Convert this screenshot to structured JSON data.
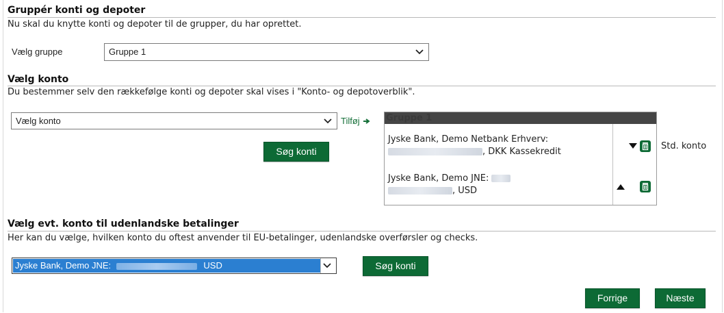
{
  "group_section": {
    "title": "Gruppér konti og depoter",
    "description": "Nu skal du knytte konti og depoter til de grupper, du har oprettet.",
    "select_label": "Vælg gruppe",
    "selected_group": "Gruppe 1"
  },
  "account_section": {
    "title": "Vælg konto",
    "description": "Du bestemmer selv den rækkefølge konti og depoter skal vises i \"Konto- og depotoverblik\".",
    "account_select_value": "Vælg konto",
    "add_link": "Tilføj",
    "search_button": "Søg konti",
    "group_box": {
      "header": "Gruppe 1",
      "items": [
        {
          "line1": "Jyske Bank, Demo Netbank Erhverv:",
          "line2_suffix": ", DKK Kassekredit",
          "badge": "Std. konto"
        },
        {
          "line1": "Jyske Bank, Demo JNE:",
          "line2_suffix": ", USD"
        }
      ]
    }
  },
  "foreign_section": {
    "title": "Vælg evt. konto til udenlandske betalinger",
    "description": "Her kan du vælge, hvilken konto du oftest anvender til EU-betalinger, udenlandske overførsler og checks.",
    "selected_prefix": "Jyske Bank, Demo JNE:",
    "selected_suffix": "USD",
    "search_button": "Søg konti"
  },
  "nav": {
    "prev_button": "Forrige",
    "next_button": "Næste"
  },
  "colors": {
    "button_green": "#0d6a35",
    "link_green": "#16703a",
    "selection_blue": "#2b7fd1",
    "group_header": "#454545"
  }
}
